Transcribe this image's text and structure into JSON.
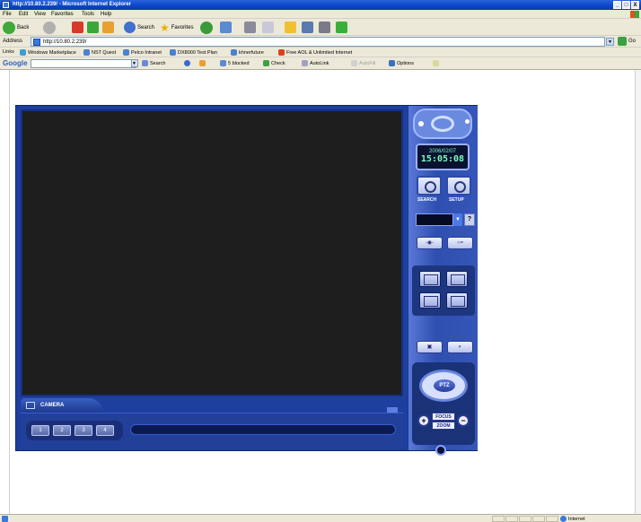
{
  "window": {
    "title": "http://10.80.2.239/ - Microsoft Internet Explorer",
    "controls": [
      "_",
      "□",
      "X"
    ]
  },
  "menu": [
    "File",
    "Edit",
    "View",
    "Favorites",
    "Tools",
    "Help"
  ],
  "toolbar": {
    "back_label": "Back",
    "search_label": "Search",
    "favorites_label": "Favorites"
  },
  "address": {
    "label": "Address",
    "url": "http://10.80.2.239/",
    "go_label": "Go"
  },
  "links": {
    "label": "Links",
    "items": [
      "Windows Marketplace",
      "NST Quest",
      "Pelco Intranet",
      "DX8000 Test Plan",
      "khnerfuture",
      "Free AOL & Unlimited Internet"
    ]
  },
  "google": {
    "logo": "Google",
    "search_label": "Search",
    "blocked_label": "5 blocked",
    "check_label": "Check",
    "autolink_label": "AutoLink",
    "autofill_label": "AutoFill",
    "options_label": "Options"
  },
  "dvr": {
    "camera_label": "CAMERA",
    "camera_buttons": [
      "1",
      "2",
      "3",
      "4"
    ],
    "date": "2006/02/07",
    "time": "15:05:08",
    "search_label": "SEARCH",
    "setup_label": "SETUP",
    "channel_help": "?",
    "ptz_label": "PTZ",
    "focus_label": "FOCUS",
    "zoom_label": "ZOOM",
    "plus": "+",
    "minus": "−"
  },
  "status": {
    "zone": "Internet"
  },
  "colors": {
    "titlebar": "#0a46c8",
    "chrome": "#ece9d8",
    "dvr_body": "#1e3f9e",
    "clock_text": "#7affc0"
  }
}
